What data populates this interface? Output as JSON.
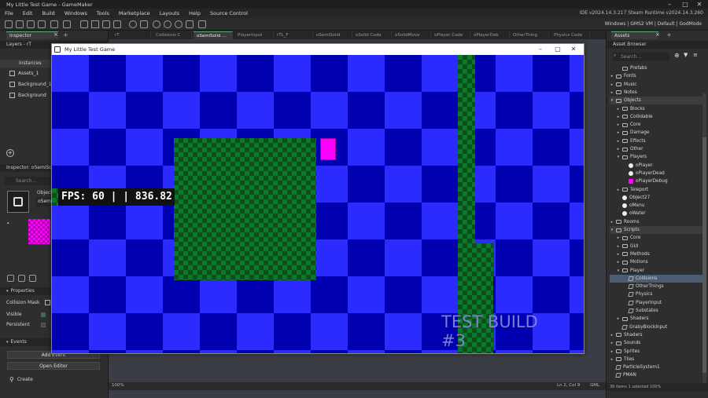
{
  "window": {
    "title": "My Little Test Game - GameMaker"
  },
  "menu": [
    "File",
    "Edit",
    "Build",
    "Windows",
    "Tools",
    "Marketplace",
    "Layouts",
    "Help",
    "Source Control"
  ],
  "ide_version": "IDE v2024.14.3.217  Steam  Runtime v2024.14.3.260",
  "target_config": "Windows | GMS2 VM | Default | GodMode",
  "left_panel": {
    "tab_label": "Inspector",
    "layers_title": "Layers - rT",
    "instances_label": "Instances",
    "layers": [
      "Assets_1",
      "Background_1",
      "Background"
    ],
    "inspector_title": "Inspector: oSemiSolid",
    "search_placeholder": "Search...",
    "object_label": "Object",
    "object_name": "oSemi",
    "properties_header": "Properties",
    "collision_mask_label": "Collision Mask",
    "visible_label": "Visible",
    "persistent_label": "Persistent",
    "events_header": "Events",
    "add_event_label": "Add Event",
    "open_editor_label": "Open Editor",
    "create_event_label": "Create"
  },
  "doc_tabs": [
    "rT",
    "Collisions C",
    "oSemiSolid ...",
    "PlayerInput",
    "rTL_F",
    "oSemiSolid",
    "oSolid Code",
    "oSolidMove",
    "oPlayer Code",
    "oPlayerDeb",
    "OtherThing",
    "Physics Code"
  ],
  "active_doc_tab_index": 2,
  "statusbar": {
    "zoom": "100%",
    "position": "Ln 2, Col 9",
    "lang": "GML"
  },
  "game_window": {
    "title": "My Little Test Game",
    "fps_text": "FPS: 60 | | 836.82",
    "test_build_line1": "TEST BUILD",
    "test_build_line2": "#3"
  },
  "asset_browser": {
    "tab_label": "Assets",
    "title": "Asset Browser",
    "search_placeholder": "Search...",
    "footer_count": "38 items",
    "footer_selected": "1 selected",
    "footer_zoom": "100%",
    "tree": [
      {
        "label": "Prefabs",
        "level": 1,
        "kind": "folder",
        "arrow": ""
      },
      {
        "label": "Fonts",
        "level": 0,
        "kind": "folder",
        "arrow": "▸"
      },
      {
        "label": "Music",
        "level": 0,
        "kind": "folder",
        "arrow": "▸"
      },
      {
        "label": "Notes",
        "level": 0,
        "kind": "folder",
        "arrow": "▸"
      },
      {
        "label": "Objects",
        "level": 0,
        "kind": "folder",
        "arrow": "▾",
        "hl": true
      },
      {
        "label": "Blocks",
        "level": 1,
        "kind": "folder",
        "arrow": "▸"
      },
      {
        "label": "Collidable",
        "level": 1,
        "kind": "folder",
        "arrow": "▸"
      },
      {
        "label": "Core",
        "level": 1,
        "kind": "folder",
        "arrow": "▸"
      },
      {
        "label": "Damage",
        "level": 1,
        "kind": "folder",
        "arrow": "▸"
      },
      {
        "label": "Effects",
        "level": 1,
        "kind": "folder",
        "arrow": "▸"
      },
      {
        "label": "Other",
        "level": 1,
        "kind": "folder",
        "arrow": "▸"
      },
      {
        "label": "Players",
        "level": 1,
        "kind": "folder",
        "arrow": "▾"
      },
      {
        "label": "oPlayer",
        "level": 2,
        "kind": "object",
        "arrow": ""
      },
      {
        "label": "oPlayerDead",
        "level": 2,
        "kind": "object",
        "arrow": ""
      },
      {
        "label": "oPlayerDebug",
        "level": 2,
        "kind": "object-pink",
        "arrow": ""
      },
      {
        "label": "Teleport",
        "level": 1,
        "kind": "folder",
        "arrow": "▸"
      },
      {
        "label": "Object27",
        "level": 1,
        "kind": "object",
        "arrow": ""
      },
      {
        "label": "oMenu",
        "level": 1,
        "kind": "object",
        "arrow": ""
      },
      {
        "label": "oWater",
        "level": 1,
        "kind": "object",
        "arrow": ""
      },
      {
        "label": "Rooms",
        "level": 0,
        "kind": "folder",
        "arrow": "▸"
      },
      {
        "label": "Scripts",
        "level": 0,
        "kind": "folder",
        "arrow": "▾",
        "hl": true
      },
      {
        "label": "Core",
        "level": 1,
        "kind": "folder",
        "arrow": "▸"
      },
      {
        "label": "GUI",
        "level": 1,
        "kind": "folder",
        "arrow": "▸"
      },
      {
        "label": "Methods",
        "level": 1,
        "kind": "folder",
        "arrow": "▸"
      },
      {
        "label": "Motions",
        "level": 1,
        "kind": "folder",
        "arrow": "▸"
      },
      {
        "label": "Player",
        "level": 1,
        "kind": "folder",
        "arrow": "▾"
      },
      {
        "label": "Collisions",
        "level": 2,
        "kind": "script",
        "arrow": "",
        "sel": true
      },
      {
        "label": "OtherThings",
        "level": 2,
        "kind": "script",
        "arrow": ""
      },
      {
        "label": "Physics",
        "level": 2,
        "kind": "script",
        "arrow": ""
      },
      {
        "label": "PlayerInput",
        "level": 2,
        "kind": "script",
        "arrow": ""
      },
      {
        "label": "Substates",
        "level": 2,
        "kind": "script",
        "arrow": ""
      },
      {
        "label": "Shaders",
        "level": 1,
        "kind": "folder",
        "arrow": "▸"
      },
      {
        "label": "GrabyBlockInput",
        "level": 1,
        "kind": "script",
        "arrow": ""
      },
      {
        "label": "Shaders",
        "level": 0,
        "kind": "folder",
        "arrow": "▸"
      },
      {
        "label": "Sounds",
        "level": 0,
        "kind": "folder",
        "arrow": "▸"
      },
      {
        "label": "Sprites",
        "level": 0,
        "kind": "folder",
        "arrow": "▸"
      },
      {
        "label": "Tiles",
        "level": 0,
        "kind": "folder",
        "arrow": "▸"
      },
      {
        "label": "ParticleSystem1",
        "level": 0,
        "kind": "script",
        "arrow": ""
      },
      {
        "label": "PMAN",
        "level": 0,
        "kind": "script",
        "arrow": ""
      }
    ]
  }
}
